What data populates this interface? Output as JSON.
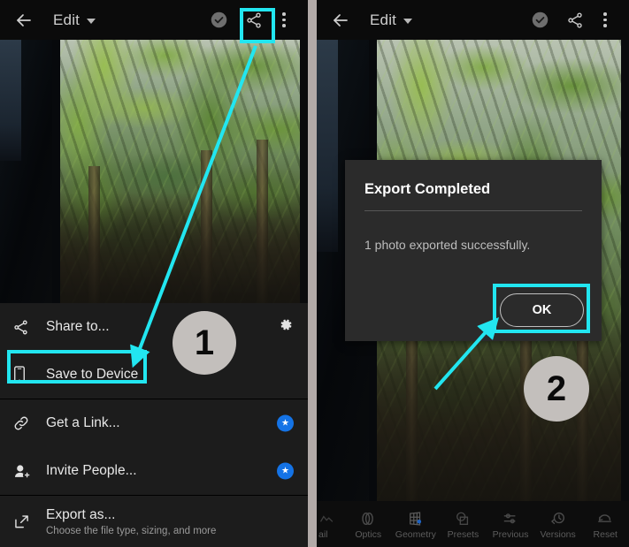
{
  "appbar": {
    "back_icon": "arrow-left-icon",
    "title": "Edit",
    "dropdown_icon": "chevron-down-icon",
    "check_icon": "check-circle-icon",
    "share_icon": "share-icon",
    "overflow_icon": "kebab-menu-icon"
  },
  "share_sheet": {
    "items": [
      {
        "label": "Share to...",
        "icon": "share-icon",
        "trailing": "gear-icon",
        "sub": ""
      },
      {
        "label": "Save to Device",
        "icon": "phone-icon",
        "trailing": "",
        "sub": ""
      },
      {
        "label": "Get a Link...",
        "icon": "link-icon",
        "trailing": "premium-star-badge",
        "sub": ""
      },
      {
        "label": "Invite People...",
        "icon": "person-add-icon",
        "trailing": "premium-star-badge",
        "sub": ""
      },
      {
        "label": "Export as...",
        "icon": "export-icon",
        "trailing": "",
        "sub": "Choose the file type, sizing, and more"
      }
    ],
    "star_glyph": "★"
  },
  "export_dialog": {
    "title": "Export Completed",
    "message": "1 photo exported successfully.",
    "ok_label": "OK"
  },
  "edit_toolbar": {
    "items": [
      {
        "label": "ail",
        "icon": "detail-icon"
      },
      {
        "label": "Optics",
        "icon": "optics-icon"
      },
      {
        "label": "Geometry",
        "icon": "geometry-icon"
      },
      {
        "label": "Presets",
        "icon": "presets-icon"
      },
      {
        "label": "Previous",
        "icon": "previous-icon"
      },
      {
        "label": "Versions",
        "icon": "versions-icon"
      },
      {
        "label": "Reset",
        "icon": "reset-icon"
      }
    ]
  },
  "annotations": {
    "highlight_color": "#22e6f0",
    "badge_color": "#c3bfbc",
    "step_one": "1",
    "step_two": "2"
  }
}
